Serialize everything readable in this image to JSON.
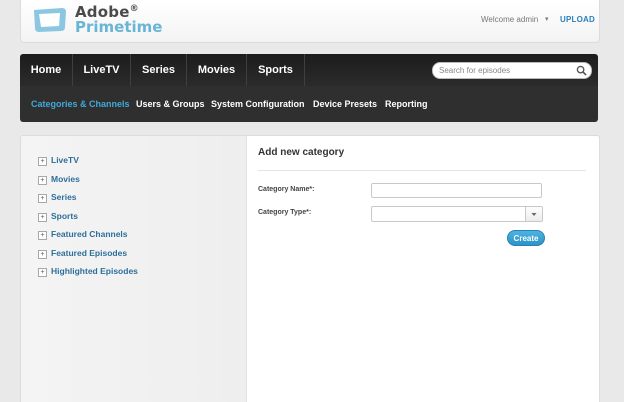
{
  "header": {
    "logo_line1": "Adobe",
    "logo_reg": "®",
    "logo_line2": "Primetime",
    "welcome": "Welcome admin",
    "upload": "UPLOAD",
    "brand_color": "#6ab5d6"
  },
  "nav": {
    "items": [
      {
        "label": "Home"
      },
      {
        "label": "LiveTV"
      },
      {
        "label": "Series"
      },
      {
        "label": "Movies"
      },
      {
        "label": "Sports"
      }
    ],
    "search_placeholder": "Search for episodes",
    "sub_items": [
      {
        "label": "Categories & Channels",
        "active": true
      },
      {
        "label": "Users & Groups"
      },
      {
        "label": "System Configuration"
      },
      {
        "label": "Device Presets"
      },
      {
        "label": "Reporting"
      }
    ],
    "accent_color": "#41a9d8"
  },
  "tree": {
    "items": [
      {
        "label": "LiveTV"
      },
      {
        "label": "Movies"
      },
      {
        "label": "Series"
      },
      {
        "label": "Sports"
      },
      {
        "label": "Featured Channels"
      },
      {
        "label": "Featured Episodes"
      },
      {
        "label": "Highlighted Episodes"
      }
    ],
    "toggle_symbol": "+"
  },
  "form": {
    "title": "Add new category",
    "name_label": "Category Name*:",
    "name_value": "",
    "type_label": "Category Type*:",
    "type_value": "",
    "create_label": "Create"
  }
}
